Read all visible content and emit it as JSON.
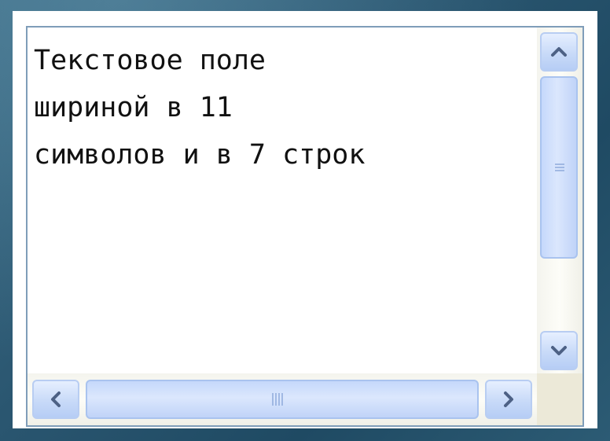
{
  "textarea": {
    "lines": [
      "Текстовое поле",
      "шириной в 11",
      "символов и в 7 строк"
    ]
  },
  "scrollbars": {
    "vertical": {
      "up_icon": "chevron-up-icon",
      "down_icon": "chevron-down-icon",
      "grip_icon": "grip-lines-icon"
    },
    "horizontal": {
      "left_icon": "chevron-left-icon",
      "right_icon": "chevron-right-icon",
      "grip_icon": "grip-lines-icon"
    }
  },
  "colors": {
    "textarea_border": "#7f9db9",
    "scroll_button": "#c8daf8",
    "arrow": "#4d6185",
    "background": "#2a5670"
  }
}
